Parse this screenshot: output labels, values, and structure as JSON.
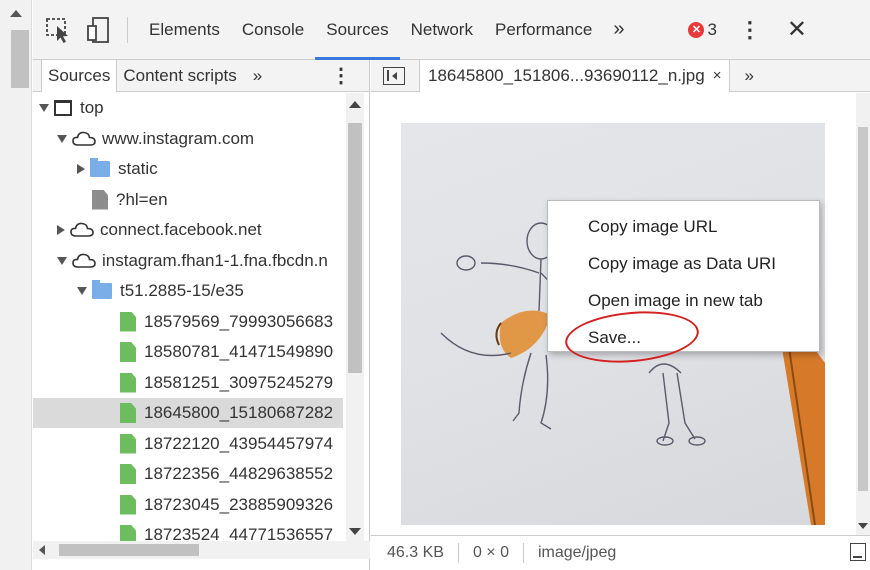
{
  "toolbar": {
    "tabs": [
      "Elements",
      "Console",
      "Sources",
      "Network",
      "Performance"
    ],
    "active_tab": "Sources",
    "more_label": "»",
    "error_count": "3",
    "error_icon_glyph": "✕",
    "kebab_label": "⋮",
    "close_label": "✕"
  },
  "navigator": {
    "tabs": [
      "Sources",
      "Content scripts"
    ],
    "more_label": "»",
    "kebab_label": "⋮",
    "tree": [
      {
        "label": "top",
        "icon": "frame-icon",
        "twisty": "down",
        "depth": 0
      },
      {
        "label": "www.instagram.com",
        "icon": "cloud-icon",
        "twisty": "down",
        "depth": 1
      },
      {
        "label": "static",
        "icon": "folder-icon",
        "twisty": "right",
        "depth": 2
      },
      {
        "label": "?hl=en",
        "icon": "document-icon",
        "twisty": "none",
        "depth": 2
      },
      {
        "label": "connect.facebook.net",
        "icon": "cloud-icon",
        "twisty": "right",
        "depth": 1
      },
      {
        "label": "instagram.fhan1-1.fna.fbcdn.n",
        "icon": "cloud-icon",
        "twisty": "down",
        "depth": 1
      },
      {
        "label": "t51.2885-15/e35",
        "icon": "folder-icon",
        "twisty": "down",
        "depth": 2
      },
      {
        "label": "18579569_79993056683",
        "icon": "image-file-icon",
        "twisty": "none",
        "depth": 3
      },
      {
        "label": "18580781_41471549890",
        "icon": "image-file-icon",
        "twisty": "none",
        "depth": 3
      },
      {
        "label": "18581251_30975245279",
        "icon": "image-file-icon",
        "twisty": "none",
        "depth": 3
      },
      {
        "label": "18645800_15180687282",
        "icon": "image-file-icon",
        "twisty": "none",
        "depth": 3,
        "selected": true
      },
      {
        "label": "18722120_43954457974",
        "icon": "image-file-icon",
        "twisty": "none",
        "depth": 3
      },
      {
        "label": "18722356_44829638552",
        "icon": "image-file-icon",
        "twisty": "none",
        "depth": 3
      },
      {
        "label": "18723045_23885909326",
        "icon": "image-file-icon",
        "twisty": "none",
        "depth": 3
      },
      {
        "label": "18723524_44771536557",
        "icon": "image-file-icon",
        "twisty": "none",
        "depth": 3
      }
    ]
  },
  "editor": {
    "file_tab": "18645800_151806...93690112_n.jpg",
    "file_tab_close": "×",
    "more_label": "»"
  },
  "status": {
    "size": "46.3 KB",
    "dimensions": "0 × 0",
    "mime": "image/jpeg"
  },
  "context_menu": {
    "items": [
      "Copy image URL",
      "Copy image as Data URI",
      "Open image in new tab",
      "Save..."
    ]
  },
  "colors": {
    "accent": "#3879d9",
    "error": "#e83a3a",
    "highlight_ring": "#d42020",
    "folder": "#7aaee8",
    "image_file": "#6dbd5e"
  }
}
